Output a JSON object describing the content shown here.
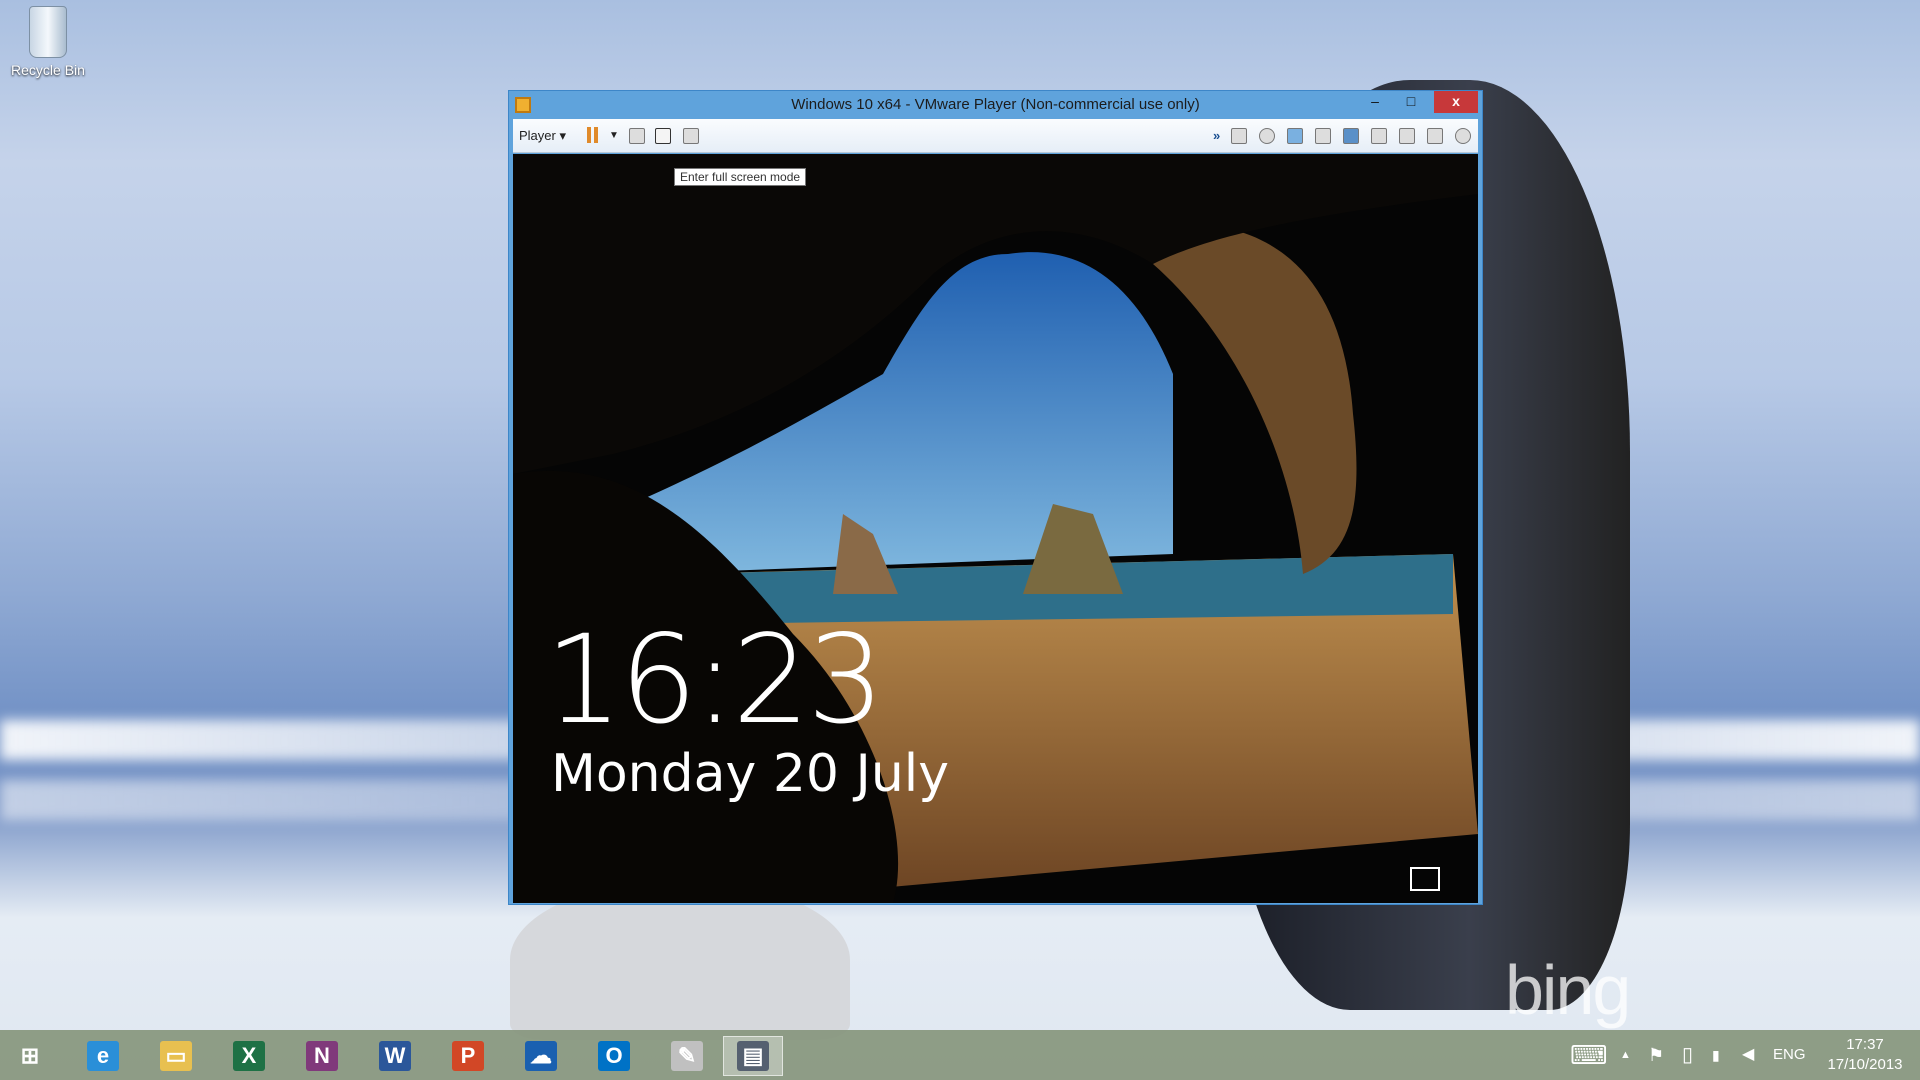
{
  "desktop": {
    "icons": [
      {
        "label": "Recycle Bin"
      }
    ],
    "watermark": "bing"
  },
  "window": {
    "title": "Windows 10 x64 - VMware Player (Non-commercial use only)",
    "controls": {
      "minimize": "–",
      "maximize": "□",
      "close": "x"
    },
    "toolbar": {
      "player_menu": "Player ▾",
      "tooltip": "Enter full screen mode"
    }
  },
  "vm": {
    "time": "16:23",
    "date": "Monday 20 July"
  },
  "taskbar": {
    "apps": [
      {
        "name": "start",
        "glyph": "⊞",
        "color": "#ffffff"
      },
      {
        "name": "internet-explorer",
        "glyph": "e",
        "color": "#2a8fd8"
      },
      {
        "name": "file-explorer",
        "glyph": "▭",
        "color": "#e8c050"
      },
      {
        "name": "excel",
        "glyph": "X",
        "color": "#1e7145"
      },
      {
        "name": "onenote",
        "glyph": "N",
        "color": "#80397b"
      },
      {
        "name": "word",
        "glyph": "W",
        "color": "#2b579a"
      },
      {
        "name": "powerpoint",
        "glyph": "P",
        "color": "#d24726"
      },
      {
        "name": "onedrive",
        "glyph": "☁",
        "color": "#1a60b0"
      },
      {
        "name": "outlook",
        "glyph": "O",
        "color": "#0072c6"
      },
      {
        "name": "paint",
        "glyph": "✎",
        "color": "#c0c0c0"
      },
      {
        "name": "vmware-player",
        "glyph": "▤",
        "color": "#556070"
      }
    ],
    "tray": {
      "language": "ENG",
      "time": "17:37",
      "date": "17/10/2013"
    }
  }
}
